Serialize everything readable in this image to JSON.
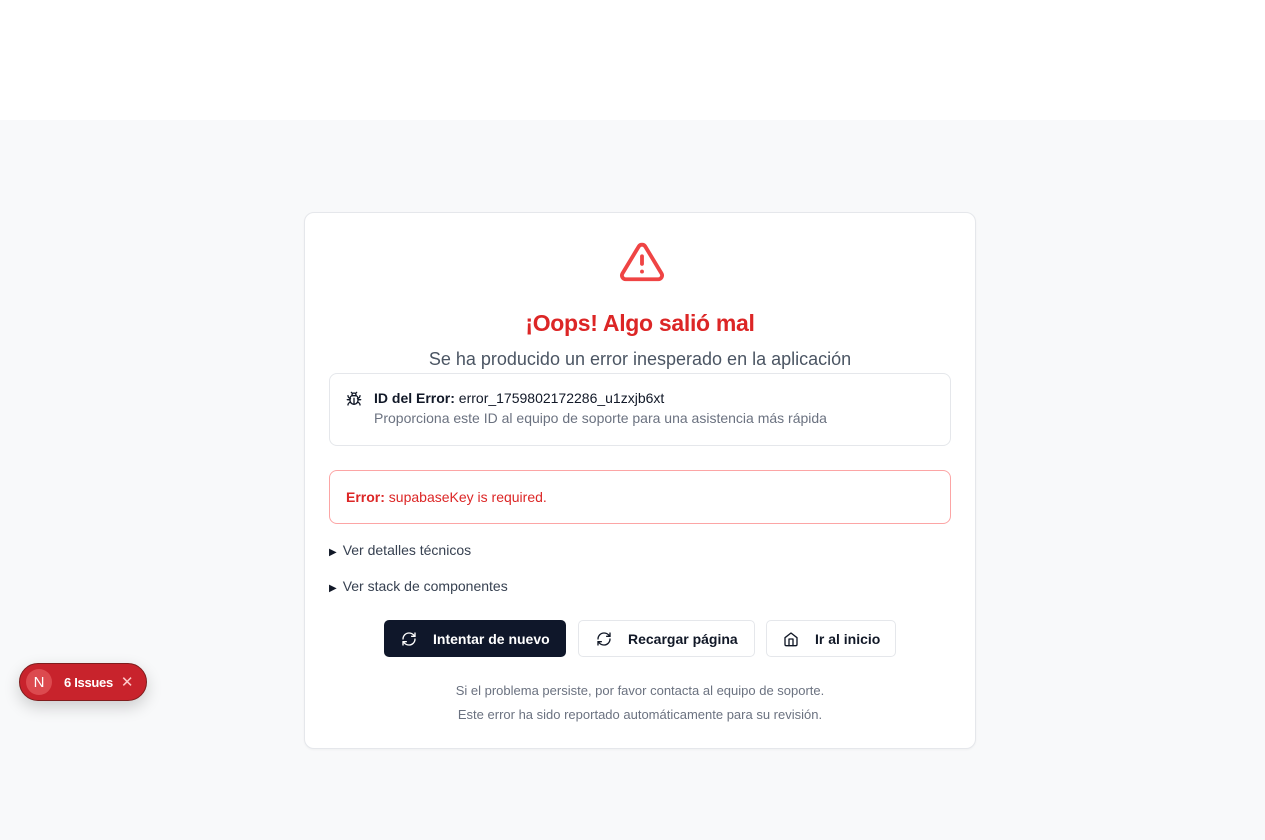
{
  "error_page": {
    "title": "¡Oops! Algo salió mal",
    "subtitle": "Se ha producido un error inesperado en la aplicación",
    "error_id_label": "ID del Error:",
    "error_id_value": "error_1759802172286_u1zxjb6xt",
    "error_id_hint": "Proporciona este ID al equipo de soporte para una asistencia más rápida",
    "error_label": "Error:",
    "error_message": "supabaseKey is required.",
    "details_technical": "Ver detalles técnicos",
    "details_stack": "Ver stack de componentes",
    "buttons": {
      "retry": "Intentar de nuevo",
      "reload": "Recargar página",
      "home": "Ir al inicio"
    },
    "footer_line1": "Si el problema persiste, por favor contacta al equipo de soporte.",
    "footer_line2": "Este error ha sido reportado automáticamente para su revisión."
  },
  "dev_indicator": {
    "logo_letter": "N",
    "issues_label": "6 Issues",
    "close_glyph": "✕"
  },
  "icons": {
    "warning": "warning-triangle-icon",
    "bug": "bug-icon",
    "refresh": "refresh-icon",
    "home": "home-icon",
    "disclosure": "triangle-right-icon"
  },
  "colors": {
    "danger": "#dc2626",
    "primary_button": "#0f172a",
    "background": "#f8f9fa",
    "issues_badge": "#c8232c"
  }
}
